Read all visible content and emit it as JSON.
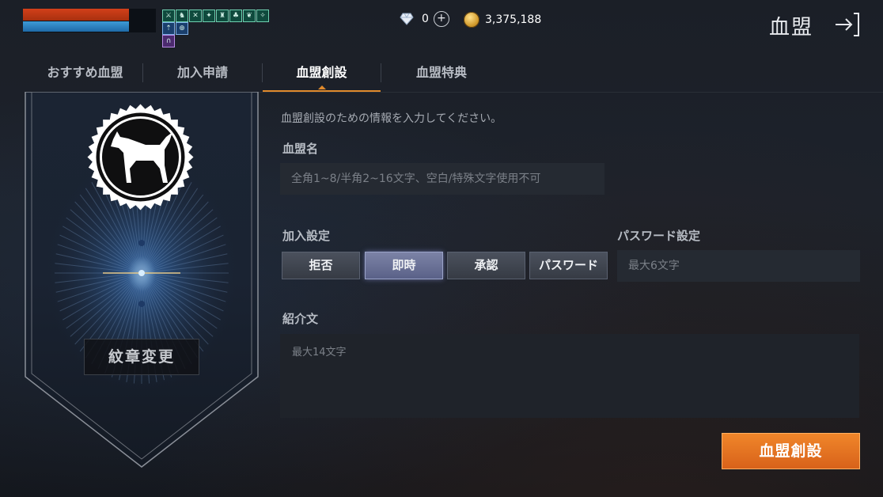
{
  "hud": {
    "hp_fraction": 0.8,
    "mp_fraction": 0.8,
    "buff_icons_row1": [
      "sword-buff-icon",
      "boot-buff-icon",
      "cross-swords-buff-icon",
      "shield-buff-icon",
      "potion-buff-icon",
      "wing-buff-icon",
      "leaf-buff-icon",
      "bird-buff-icon"
    ],
    "buff_icons_row2": [
      "arrow-buff-icon",
      "target-buff-icon"
    ],
    "buff_icons_row3": [
      "arch-buff-icon"
    ]
  },
  "currency": {
    "gem_amount": "0",
    "gold_amount": "3,375,188"
  },
  "header": {
    "title": "血盟"
  },
  "tabs": [
    {
      "label": "おすすめ血盟",
      "active": false
    },
    {
      "label": "加入申請",
      "active": false
    },
    {
      "label": "血盟創設",
      "active": true
    },
    {
      "label": "血盟特典",
      "active": false
    }
  ],
  "emblem": {
    "icon": "dog-icon",
    "change_label": "紋章変更"
  },
  "form": {
    "hint": "血盟創設のための情報を入力してください。",
    "name_label": "血盟名",
    "name_placeholder": "全角1~8/半角2~16文字、空白/特殊文字使用不可",
    "join_label": "加入設定",
    "join_options": [
      "拒否",
      "即時",
      "承認",
      "パスワード"
    ],
    "join_selected": "即時",
    "password_label": "パスワード設定",
    "password_placeholder": "最大6文字",
    "intro_label": "紹介文",
    "intro_placeholder": "最大14文字",
    "create_label": "血盟創設"
  },
  "colors": {
    "accent_orange": "#e08a2c",
    "hp_red": "#d2401a",
    "mp_blue": "#3d9ad6",
    "selected_purple": "#6a71a0"
  }
}
